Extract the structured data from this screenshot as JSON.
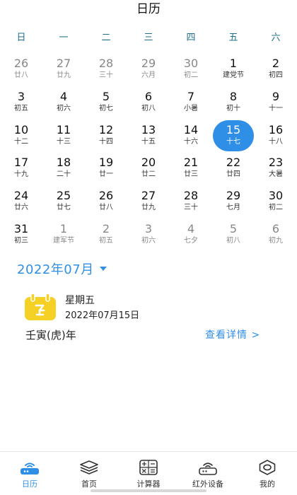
{
  "header": {
    "title": "日历"
  },
  "weekdays": [
    "日",
    "一",
    "二",
    "三",
    "四",
    "五",
    "六"
  ],
  "calendar": {
    "weeks": [
      [
        {
          "num": "26",
          "lunar": "廿八",
          "other": true
        },
        {
          "num": "27",
          "lunar": "廿九",
          "other": true
        },
        {
          "num": "28",
          "lunar": "三十",
          "other": true
        },
        {
          "num": "29",
          "lunar": "六月",
          "other": true
        },
        {
          "num": "30",
          "lunar": "初二",
          "other": true
        },
        {
          "num": "1",
          "lunar": "建党节"
        },
        {
          "num": "2",
          "lunar": "初四"
        }
      ],
      [
        {
          "num": "3",
          "lunar": "初五"
        },
        {
          "num": "4",
          "lunar": "初六"
        },
        {
          "num": "5",
          "lunar": "初七"
        },
        {
          "num": "6",
          "lunar": "初八"
        },
        {
          "num": "7",
          "lunar": "小暑"
        },
        {
          "num": "8",
          "lunar": "初十"
        },
        {
          "num": "9",
          "lunar": "十一"
        }
      ],
      [
        {
          "num": "10",
          "lunar": "十二"
        },
        {
          "num": "11",
          "lunar": "十三"
        },
        {
          "num": "12",
          "lunar": "十四"
        },
        {
          "num": "13",
          "lunar": "十五"
        },
        {
          "num": "14",
          "lunar": "十六"
        },
        {
          "num": "15",
          "lunar": "十七",
          "selected": true
        },
        {
          "num": "16",
          "lunar": "十八"
        }
      ],
      [
        {
          "num": "17",
          "lunar": "十九"
        },
        {
          "num": "18",
          "lunar": "二十"
        },
        {
          "num": "19",
          "lunar": "廿一"
        },
        {
          "num": "20",
          "lunar": "廿二"
        },
        {
          "num": "21",
          "lunar": "廿三"
        },
        {
          "num": "22",
          "lunar": "廿四"
        },
        {
          "num": "23",
          "lunar": "大暑"
        }
      ],
      [
        {
          "num": "24",
          "lunar": "廿六"
        },
        {
          "num": "25",
          "lunar": "廿七"
        },
        {
          "num": "26",
          "lunar": "廿八"
        },
        {
          "num": "27",
          "lunar": "廿九"
        },
        {
          "num": "28",
          "lunar": "三十"
        },
        {
          "num": "29",
          "lunar": "七月"
        },
        {
          "num": "30",
          "lunar": "初二"
        }
      ],
      [
        {
          "num": "31",
          "lunar": "初三"
        },
        {
          "num": "1",
          "lunar": "建军节",
          "other": true
        },
        {
          "num": "2",
          "lunar": "初五",
          "other": true
        },
        {
          "num": "3",
          "lunar": "初六",
          "other": true
        },
        {
          "num": "4",
          "lunar": "七夕",
          "other": true
        },
        {
          "num": "5",
          "lunar": "初八",
          "other": true
        },
        {
          "num": "6",
          "lunar": "初九",
          "other": true
        }
      ]
    ]
  },
  "month_picker": {
    "label": "2022年07月"
  },
  "selected_date": {
    "weekday": "星期五",
    "full_date": "2022年07月15日",
    "ganzhi": "壬寅(虎)年",
    "details_link": "查看详情 >"
  },
  "tabs": [
    {
      "label": "日历",
      "icon": "calendar-router-icon",
      "active": true
    },
    {
      "label": "首页",
      "icon": "layers-icon"
    },
    {
      "label": "计算器",
      "icon": "calculator-icon"
    },
    {
      "label": "红外设备",
      "icon": "router-icon"
    },
    {
      "label": "我的",
      "icon": "hexagon-icon"
    }
  ],
  "colors": {
    "accent": "#2f8fe6",
    "weekday_header": "#1f6f8b",
    "muted": "#888888",
    "icon_yellow": "#f6d125"
  }
}
